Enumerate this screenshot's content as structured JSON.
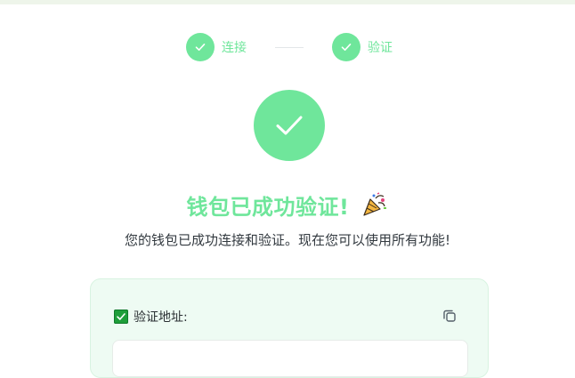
{
  "stepper": {
    "steps": [
      {
        "label": "连接",
        "completed": true
      },
      {
        "label": "验证",
        "completed": true
      }
    ]
  },
  "success": {
    "title": "钱包已成功验证!",
    "emoji": "party-popper-icon",
    "subtitle": "您的钱包已成功连接和验证。现在您可以使用所有功能!"
  },
  "card": {
    "label": "验证地址:",
    "address_value": ""
  },
  "colors": {
    "accent": "#6fe69b",
    "checkbox": "#1e9e3a",
    "card_bg": "#eefbf3",
    "text": "#333a40"
  }
}
